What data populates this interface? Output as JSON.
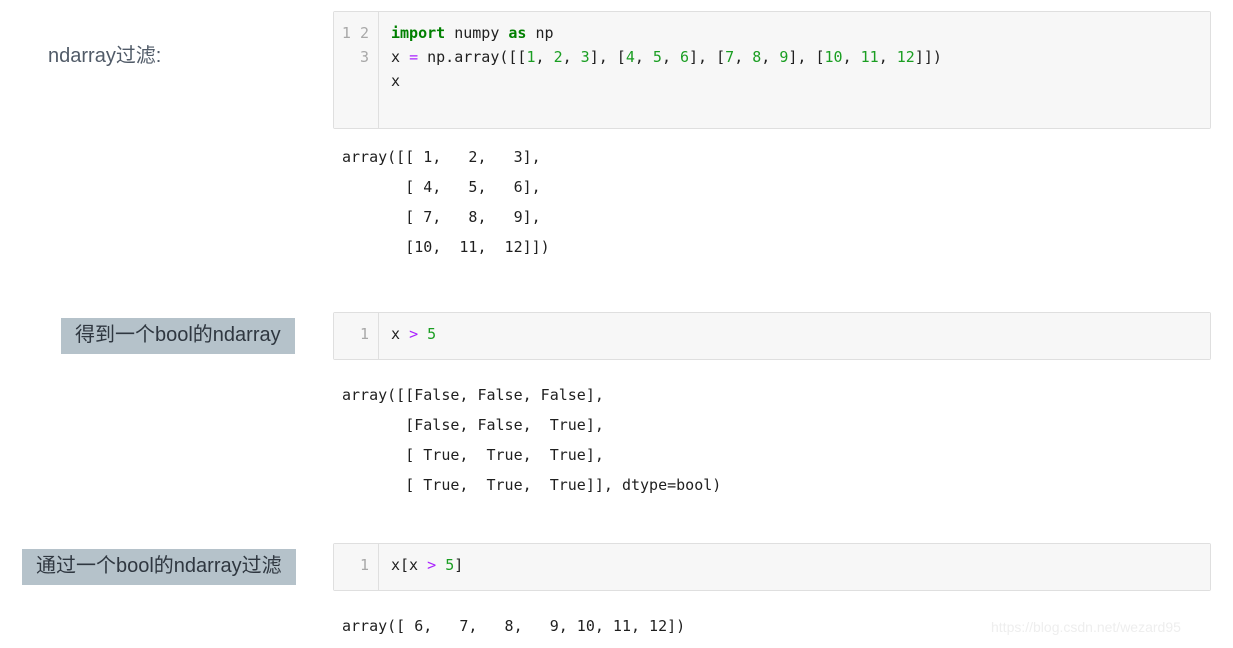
{
  "annotations": {
    "first_label": "ndarray过滤:",
    "second_label": "得到一个bool的ndarray",
    "third_label": "通过一个bool的ndarray过滤"
  },
  "cells": [
    {
      "id": "cell-1",
      "line_numbers": [
        "1",
        "2",
        "3"
      ],
      "lines": [
        [
          {
            "t": "import",
            "c": "kw"
          },
          {
            "t": " numpy ",
            "c": ""
          },
          {
            "t": "as",
            "c": "kw"
          },
          {
            "t": " np",
            "c": ""
          }
        ],
        [
          {
            "t": "x ",
            "c": ""
          },
          {
            "t": "=",
            "c": "op"
          },
          {
            "t": " np.array([[",
            "c": ""
          },
          {
            "t": "1",
            "c": "num"
          },
          {
            "t": ", ",
            "c": ""
          },
          {
            "t": "2",
            "c": "num"
          },
          {
            "t": ", ",
            "c": ""
          },
          {
            "t": "3",
            "c": "num"
          },
          {
            "t": "], [",
            "c": ""
          },
          {
            "t": "4",
            "c": "num"
          },
          {
            "t": ", ",
            "c": ""
          },
          {
            "t": "5",
            "c": "num"
          },
          {
            "t": ", ",
            "c": ""
          },
          {
            "t": "6",
            "c": "num"
          },
          {
            "t": "], [",
            "c": ""
          },
          {
            "t": "7",
            "c": "num"
          },
          {
            "t": ", ",
            "c": ""
          },
          {
            "t": "8",
            "c": "num"
          },
          {
            "t": ", ",
            "c": ""
          },
          {
            "t": "9",
            "c": "num"
          },
          {
            "t": "], [",
            "c": ""
          },
          {
            "t": "10",
            "c": "num"
          },
          {
            "t": ", ",
            "c": ""
          },
          {
            "t": "11",
            "c": "num"
          },
          {
            "t": ", ",
            "c": ""
          },
          {
            "t": "12",
            "c": "num"
          },
          {
            "t": "]])",
            "c": ""
          }
        ],
        [
          {
            "t": "x",
            "c": ""
          }
        ]
      ],
      "source_text": "import numpy as np\nx = np.array([[1, 2, 3], [4, 5, 6], [7, 8, 9], [10, 11, 12]])\nx"
    },
    {
      "id": "cell-2",
      "line_numbers": [
        "1"
      ],
      "lines": [
        [
          {
            "t": "x ",
            "c": ""
          },
          {
            "t": ">",
            "c": "op"
          },
          {
            "t": " ",
            "c": ""
          },
          {
            "t": "5",
            "c": "num"
          }
        ]
      ],
      "source_text": "x > 5"
    },
    {
      "id": "cell-3",
      "line_numbers": [
        "1"
      ],
      "lines": [
        [
          {
            "t": "x[x ",
            "c": ""
          },
          {
            "t": ">",
            "c": "op"
          },
          {
            "t": " ",
            "c": ""
          },
          {
            "t": "5",
            "c": "num"
          },
          {
            "t": "]",
            "c": ""
          }
        ]
      ],
      "source_text": "x[x > 5]"
    }
  ],
  "outputs": {
    "output_1": "array([[ 1,   2,   3],\n       [ 4,   5,   6],\n       [ 7,   8,   9],\n       [10,  11,  12]])",
    "output_2": "array([[False, False, False],\n       [False, False,  True],\n       [ True,  True,  True],\n       [ True,  True,  True]], dtype=bool)",
    "output_3": "array([ 6,   7,   8,   9, 10, 11, 12])"
  },
  "watermark": "https://blog.csdn.net/wezard95",
  "colors": {
    "highlight": "#b5c2ca",
    "keyword": "#008000",
    "number": "#1a9e22",
    "operator": "#aa22ff",
    "cell_bg": "#f7f7f7",
    "cell_border": "#dfdfdf",
    "gutter_text": "#a8a8a8"
  }
}
